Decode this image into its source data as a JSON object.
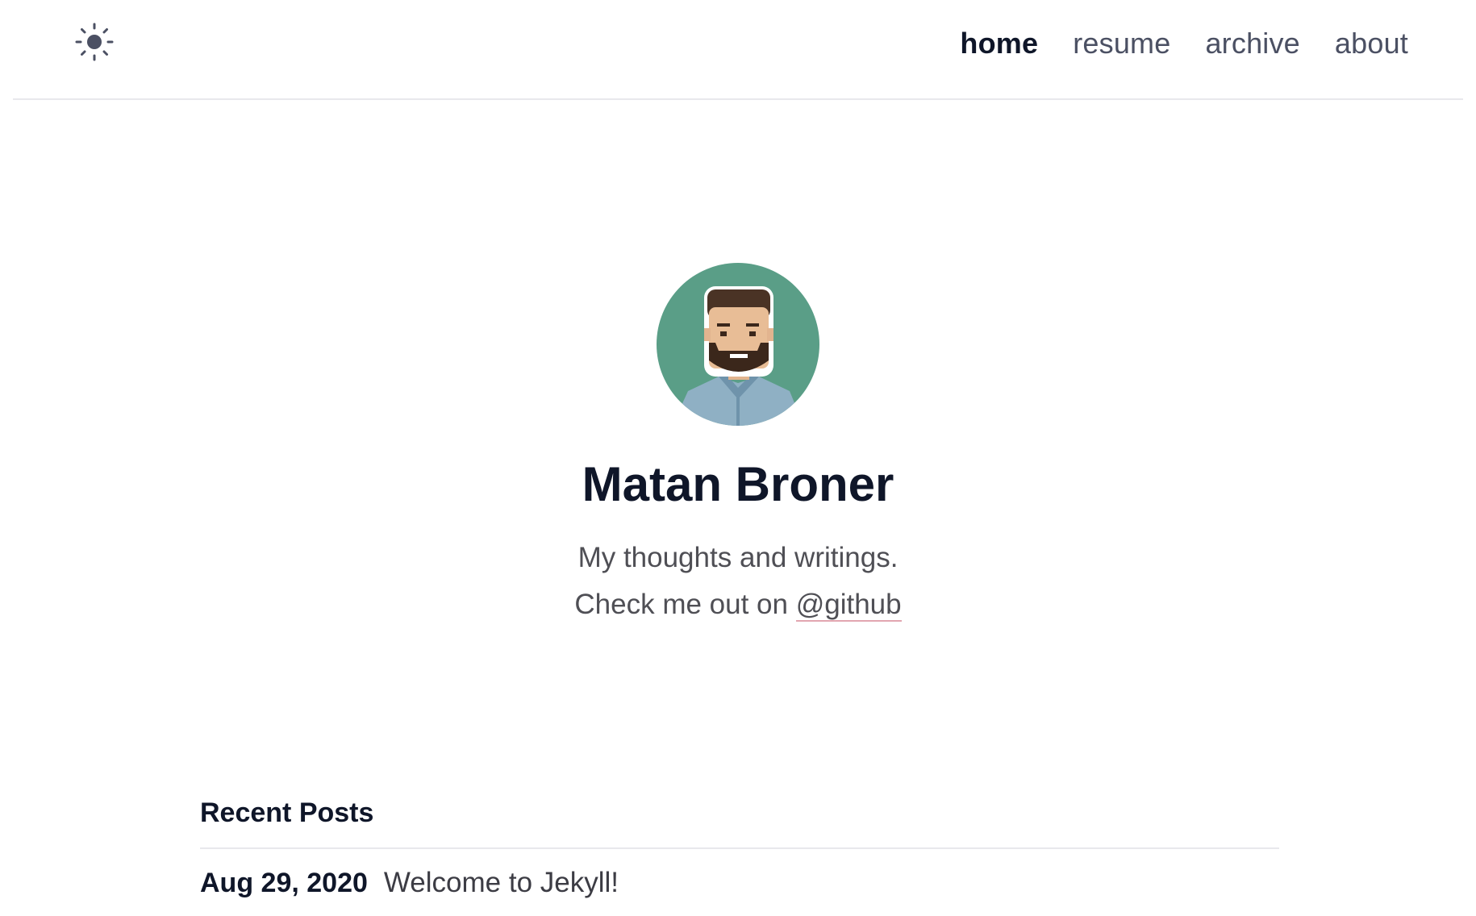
{
  "header": {
    "theme_toggle_icon": "sun-icon",
    "nav": [
      {
        "label": "home",
        "active": true
      },
      {
        "label": "resume",
        "active": false
      },
      {
        "label": "archive",
        "active": false
      },
      {
        "label": "about",
        "active": false
      }
    ]
  },
  "profile": {
    "avatar_icon": "avatar-icon",
    "name": "Matan Broner",
    "tagline": "My thoughts and writings.",
    "social_prefix": "Check me out on",
    "social_link": "@github"
  },
  "recent_posts": {
    "title": "Recent Posts",
    "posts": [
      {
        "date": "Aug 29, 2020",
        "title": "Welcome to Jekyll!"
      }
    ]
  },
  "colors": {
    "heading": "#0f1629",
    "nav_inactive": "#4b5063",
    "body_text": "#4f4f55",
    "avatar_bg": "#5a9e87",
    "link_underline": "#e2a6b0"
  }
}
